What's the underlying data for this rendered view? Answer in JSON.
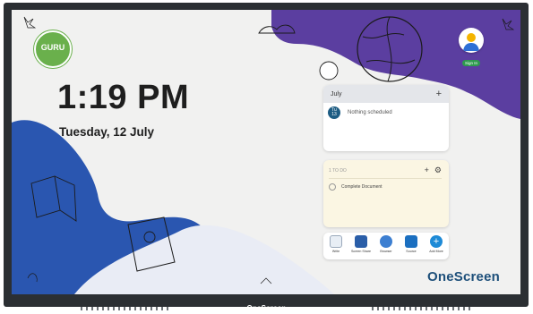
{
  "home": {
    "time": "1:19 PM",
    "date": "Tuesday, 12 July",
    "badge": "GURU"
  },
  "account": {
    "sign_in_label": "Sign In"
  },
  "calendar": {
    "month": "July",
    "add_icon": "plus-icon",
    "day_label": "Tu",
    "day_number": "13",
    "empty_text": "Nothing scheduled"
  },
  "todo": {
    "header": "1 TO DO",
    "item": "Complete Document"
  },
  "dock": {
    "apps": [
      {
        "label": "Write",
        "color": "#e8eef5"
      },
      {
        "label": "Screen Share",
        "color": "#2a5ea8"
      },
      {
        "label": "Browser",
        "color": "#3d7fd1"
      },
      {
        "label": "Source",
        "color": "#1b6fc0"
      },
      {
        "label": "Add More",
        "color": "#1e8ad6"
      }
    ]
  },
  "brand": "OneScreen",
  "bezel_brand": "OneScreen",
  "colors": {
    "purple": "#5b3ea0",
    "blue": "#2a56b0",
    "green": "#6ab04c"
  }
}
